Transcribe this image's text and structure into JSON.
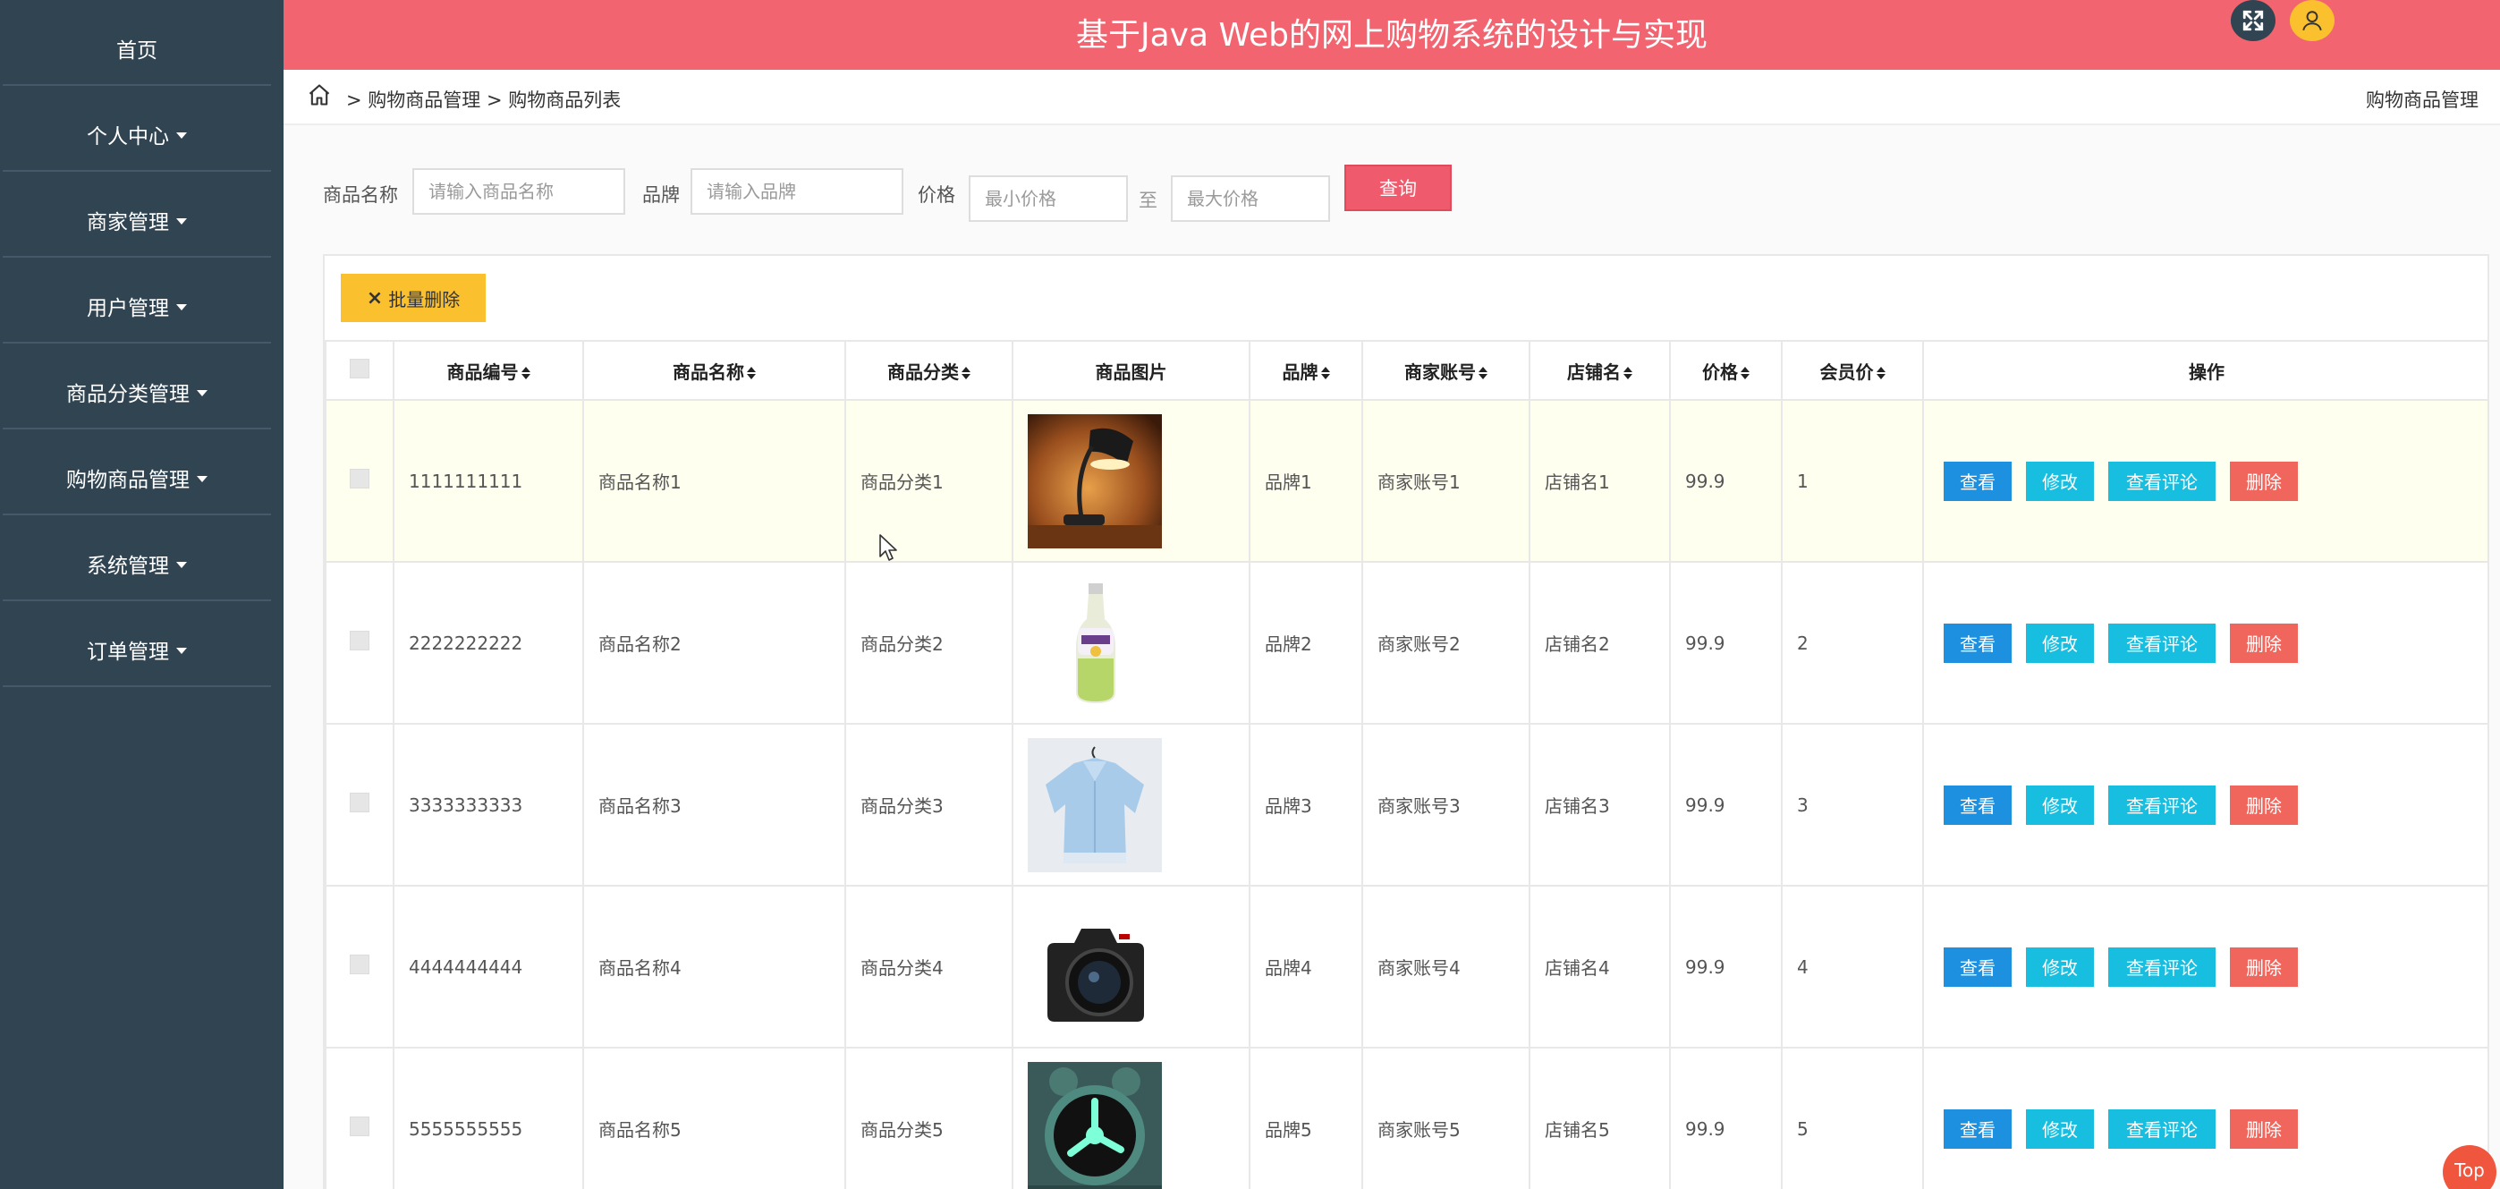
{
  "header": {
    "title": "基于Java Web的网上购物系统的设计与实现"
  },
  "sidebar": {
    "items": [
      {
        "label": "首页",
        "dropdown": false
      },
      {
        "label": "个人中心",
        "dropdown": true
      },
      {
        "label": "商家管理",
        "dropdown": true
      },
      {
        "label": "用户管理",
        "dropdown": true
      },
      {
        "label": "商品分类管理",
        "dropdown": true
      },
      {
        "label": "购物商品管理",
        "dropdown": true
      },
      {
        "label": "系统管理",
        "dropdown": true
      },
      {
        "label": "订单管理",
        "dropdown": true
      }
    ]
  },
  "breadcrumb": {
    "path": "> 购物商品管理 > 购物商品列表",
    "right": "购物商品管理"
  },
  "search": {
    "name_label": "商品名称",
    "name_placeholder": "请输入商品名称",
    "brand_label": "品牌",
    "brand_placeholder": "请输入品牌",
    "price_label": "价格",
    "min_placeholder": "最小价格",
    "to_label": "至",
    "max_placeholder": "最大价格",
    "query_label": "查询"
  },
  "toolbar": {
    "batch_delete_label": "批量删除"
  },
  "table": {
    "headers": [
      "商品编号",
      "商品名称",
      "商品分类",
      "商品图片",
      "品牌",
      "商家账号",
      "店铺名",
      "价格",
      "会员价",
      "操作"
    ],
    "actions": {
      "view": "查看",
      "edit": "修改",
      "comments": "查看评论",
      "delete": "删除"
    },
    "rows": [
      {
        "id": "1111111111",
        "name": "商品名称1",
        "category": "商品分类1",
        "image": "desk-lamp",
        "brand": "品牌1",
        "merchant": "商家账号1",
        "shop": "店铺名1",
        "price": "99.9",
        "member_price": "1"
      },
      {
        "id": "2222222222",
        "name": "商品名称2",
        "category": "商品分类2",
        "image": "drink-bottle",
        "brand": "品牌2",
        "merchant": "商家账号2",
        "shop": "店铺名2",
        "price": "99.9",
        "member_price": "2"
      },
      {
        "id": "3333333333",
        "name": "商品名称3",
        "category": "商品分类3",
        "image": "blouse",
        "brand": "品牌3",
        "merchant": "商家账号3",
        "shop": "店铺名3",
        "price": "99.9",
        "member_price": "3"
      },
      {
        "id": "4444444444",
        "name": "商品名称4",
        "category": "商品分类4",
        "image": "camera",
        "brand": "品牌4",
        "merchant": "商家账号4",
        "shop": "店铺名4",
        "price": "99.9",
        "member_price": "4"
      },
      {
        "id": "5555555555",
        "name": "商品名称5",
        "category": "商品分类5",
        "image": "alarm-clock",
        "brand": "品牌5",
        "merchant": "商家账号5",
        "shop": "店铺名5",
        "price": "99.9",
        "member_price": "5"
      }
    ]
  },
  "top_button": {
    "label": "Top"
  },
  "colors": {
    "sidebar_bg": "#304452",
    "header_bg": "#f16470",
    "query_btn": "#ef5b6c",
    "batch_btn": "#fbc02d",
    "view_btn": "#1e90e0",
    "edit_btn": "#17bee0",
    "delete_btn": "#f0665c",
    "highlight_row": "#fffff0"
  }
}
